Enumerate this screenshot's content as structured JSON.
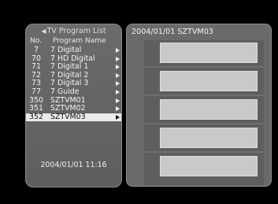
{
  "list_panel": {
    "title": "TV Program List",
    "headers": {
      "no": "No.",
      "name": "Program Name"
    },
    "items": [
      {
        "no": "7",
        "name": "7 Digital"
      },
      {
        "no": "70",
        "name": "7 HD Digital"
      },
      {
        "no": "71",
        "name": "7 Digital 1"
      },
      {
        "no": "72",
        "name": "7 Digital 2"
      },
      {
        "no": "73",
        "name": "7 Digital 3"
      },
      {
        "no": "77",
        "name": "7 Guide"
      },
      {
        "no": "350",
        "name": "SZTVM01"
      },
      {
        "no": "351",
        "name": "SZTVM02"
      },
      {
        "no": "352",
        "name": "SZTVM03"
      }
    ],
    "selected_index": 8,
    "datetime": "2004/01/01 11:16"
  },
  "epg_panel": {
    "title": "2004/01/01 SZTVM03",
    "slot_count": 5
  },
  "colors": {
    "panel_bg": "#6b6b6b",
    "selected_row": "#eaeaea",
    "epg_slot": "#c9c9c9"
  },
  "icons": [
    "left-triangle-icon",
    "right-triangle-icon"
  ]
}
